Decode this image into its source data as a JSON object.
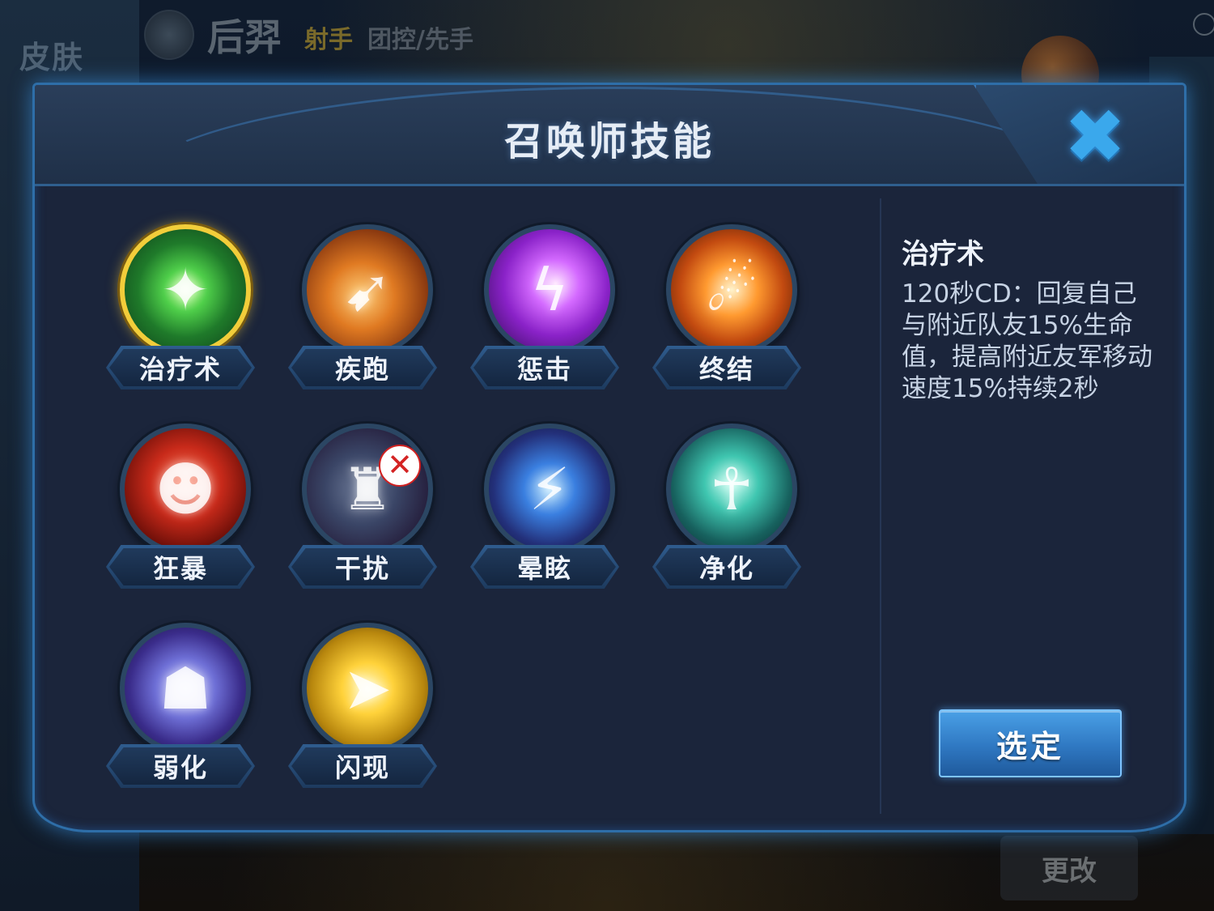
{
  "background": {
    "skin_label": "皮肤",
    "hero_name": "后羿",
    "hero_role": "射手",
    "hero_tags": "团控/先手",
    "change_button": "更改"
  },
  "dialog": {
    "title": "召唤师技能",
    "close_icon": "close-x-icon"
  },
  "skills": [
    {
      "label": "治疗术",
      "icon": "heal-icon",
      "selected": true,
      "banned": false
    },
    {
      "label": "疾跑",
      "icon": "sprint-icon",
      "selected": false,
      "banned": false
    },
    {
      "label": "惩击",
      "icon": "smite-icon",
      "selected": false,
      "banned": false
    },
    {
      "label": "终结",
      "icon": "execute-icon",
      "selected": false,
      "banned": false
    },
    {
      "label": "狂暴",
      "icon": "rage-icon",
      "selected": false,
      "banned": false
    },
    {
      "label": "干扰",
      "icon": "disrupt-icon",
      "selected": false,
      "banned": true
    },
    {
      "label": "晕眩",
      "icon": "stun-icon",
      "selected": false,
      "banned": false
    },
    {
      "label": "净化",
      "icon": "purify-icon",
      "selected": false,
      "banned": false
    },
    {
      "label": "弱化",
      "icon": "weaken-icon",
      "selected": false,
      "banned": false
    },
    {
      "label": "闪现",
      "icon": "flash-icon",
      "selected": false,
      "banned": false
    }
  ],
  "description": {
    "title": "治疗术",
    "text": "120秒CD：回复自己与附近队友15%生命值，提高附近友军移动速度15%持续2秒"
  },
  "select_button": "选定",
  "colors": {
    "selected_ring": "#f2cd3a",
    "accent_blue": "#3aa8ec",
    "panel_bg": "#1b253b"
  }
}
